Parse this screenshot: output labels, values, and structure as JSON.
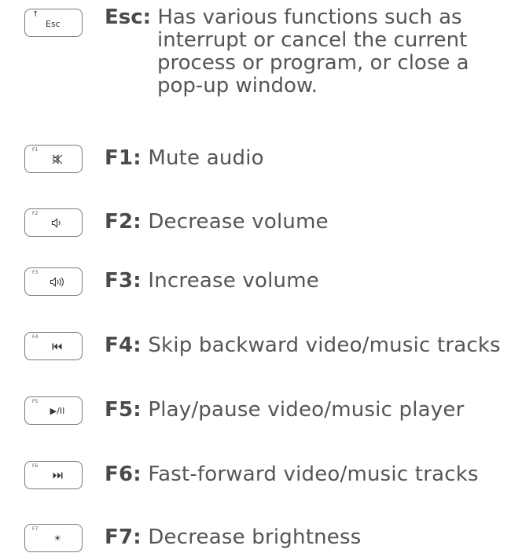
{
  "esc": {
    "key_label": "Esc",
    "key_arrow": "↑",
    "title": "Esc:",
    "lines": [
      "Has various functions such as",
      "interrupt or cancel the current",
      "process or program, or close a",
      "pop-up window."
    ]
  },
  "keys": [
    {
      "fn": "F1",
      "icon": "mute-icon",
      "title": "F1:",
      "text": "Mute audio"
    },
    {
      "fn": "F2",
      "icon": "volume-down-icon",
      "title": "F2:",
      "text": "Decrease volume"
    },
    {
      "fn": "F3",
      "icon": "volume-up-icon",
      "title": "F3:",
      "text": "Increase volume"
    },
    {
      "fn": "F4",
      "icon": "skip-backward-icon",
      "glyph": "⏮",
      "title": "F4:",
      "text": "Skip backward video/music tracks"
    },
    {
      "fn": "F5",
      "icon": "play-pause-icon",
      "glyph": "▶/II",
      "title": "F5:",
      "text": "Play/pause video/music player"
    },
    {
      "fn": "F6",
      "icon": "fast-forward-icon",
      "glyph": "⏭",
      "title": "F6:",
      "text": "Fast-forward video/music tracks"
    },
    {
      "fn": "F7",
      "icon": "brightness-down-icon",
      "glyph": "☀",
      "title": "F7:",
      "text": "Decrease brightness"
    }
  ],
  "colors": {
    "text": "#555555",
    "label": "#4a4a4a",
    "key_border": "#7a7a7a"
  }
}
